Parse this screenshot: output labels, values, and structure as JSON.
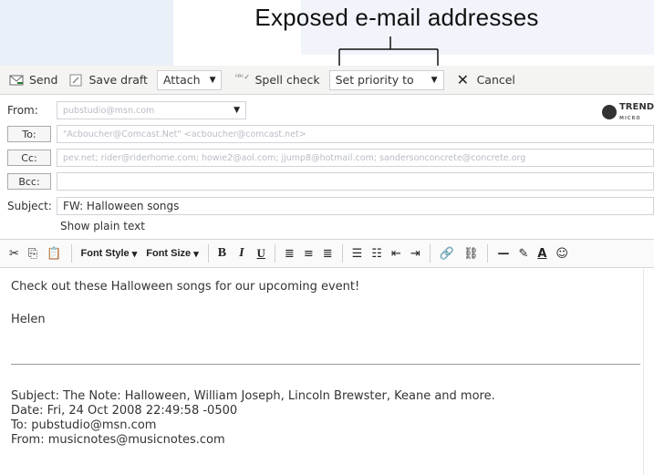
{
  "callout": {
    "title": "Exposed e-mail addresses"
  },
  "toolbar": {
    "send_label": "Send",
    "save_draft_label": "Save draft",
    "attach_label": "Attach",
    "spell_check_label": "Spell check",
    "priority_label": "Set priority to",
    "cancel_label": "Cancel"
  },
  "header": {
    "from_label": "From:",
    "from_value": "pubstudio@msn.com",
    "to_button": "To:",
    "to_value": "\"Acboucher@Comcast.Net\" <acboucher@comcast.net>",
    "cc_button": "Cc:",
    "cc_value": "pev.net; rider@riderhome.com; howie2@aol.com; jjump8@hotmail.com; sandersonconcrete@concrete.org",
    "bcc_button": "Bcc:",
    "bcc_value": "",
    "subject_label": "Subject:",
    "subject_value": "FW: Halloween songs",
    "plain_text_link": "Show plain text",
    "logo_text": "TREND",
    "logo_sub": "MICRO"
  },
  "format_bar": {
    "font_style": "Font Style",
    "font_size": "Font Size",
    "bold": "B",
    "italic": "I",
    "underline": "U"
  },
  "message": {
    "line1": "Check out these Halloween songs for our upcoming event!",
    "signature": "Helen",
    "fwd_subject": "Subject: The Note: Halloween, William Joseph, Lincoln Brewster, Keane and more.",
    "fwd_date": "Date: Fri, 24 Oct 2008 22:49:58 -0500",
    "fwd_to": "To: pubstudio@msn.com",
    "fwd_from": "From: musicnotes@musicnotes.com"
  }
}
